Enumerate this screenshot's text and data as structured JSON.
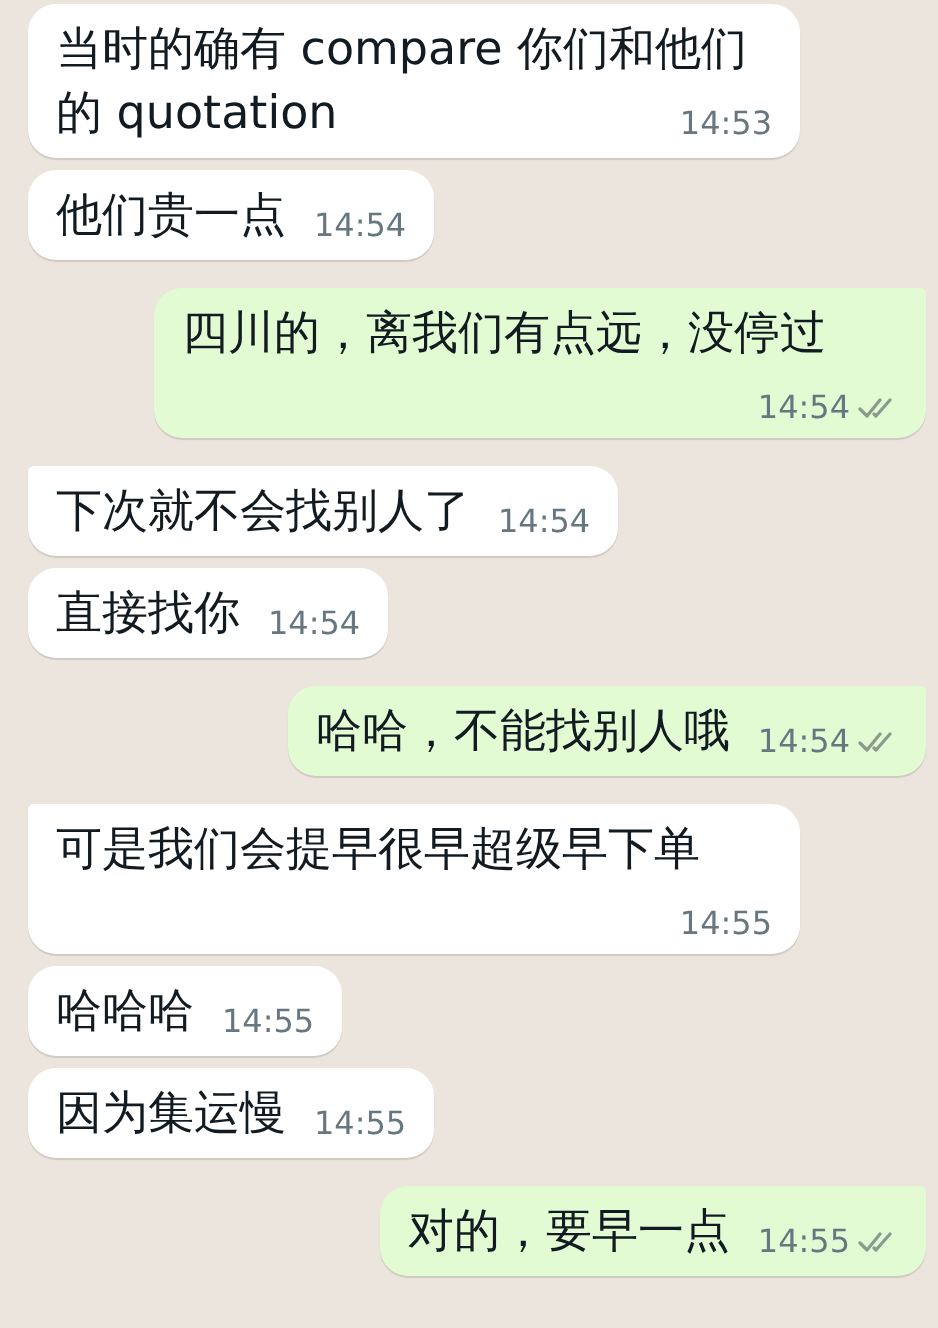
{
  "messages": [
    {
      "kind": "received",
      "text": "当时的确有 compare 你们和他们的 quotation",
      "time": "14:53"
    },
    {
      "kind": "received",
      "text": "他们贵一点",
      "time": "14:54"
    },
    {
      "kind": "sent",
      "text": "四川的，离我们有点远，没停过",
      "time": "14:54",
      "read": false
    },
    {
      "kind": "received",
      "text": "下次就不会找别人了",
      "time": "14:54"
    },
    {
      "kind": "received",
      "text": "直接找你",
      "time": "14:54"
    },
    {
      "kind": "sent",
      "text": "哈哈，不能找别人哦",
      "time": "14:54",
      "read": false
    },
    {
      "kind": "received",
      "text": "可是我们会提早很早超级早下单",
      "time": "14:55"
    },
    {
      "kind": "received",
      "text": "哈哈哈",
      "time": "14:55"
    },
    {
      "kind": "received",
      "text": "因为集运慢",
      "time": "14:55"
    },
    {
      "kind": "sent",
      "text": "对的，要早一点",
      "time": "14:55",
      "read": false
    }
  ]
}
